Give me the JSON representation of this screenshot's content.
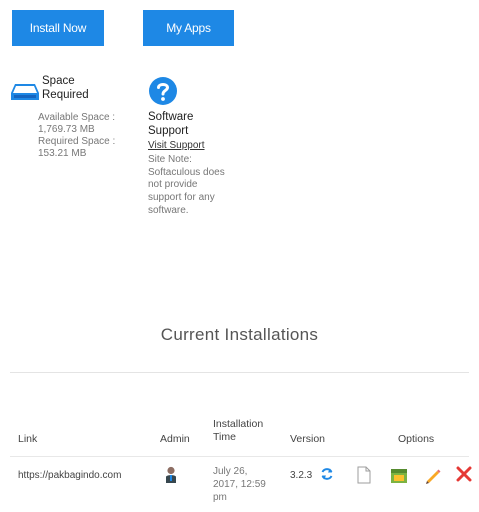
{
  "toolbar": {
    "install_label": "Install Now",
    "myapps_label": "My Apps"
  },
  "space": {
    "title": "Space Required",
    "detail": "Available Space : 1,769.73 MB Required Space : 153.21 MB"
  },
  "support": {
    "title": "Software Support",
    "link": "Visit Support",
    "note": "Site Note: Softaculous does not provide support for any software."
  },
  "section_title": "Current Installations",
  "table": {
    "headers": {
      "link": "Link",
      "admin": "Admin",
      "installation_time": "Installation Time",
      "version": "Version",
      "options": "Options"
    },
    "rows": [
      {
        "link": "https://pakbagindo.com",
        "time": "July 26, 2017, 12:59 pm",
        "version": "3.2.3"
      }
    ]
  },
  "colors": {
    "accent": "#1e88e5",
    "delete": "#e53935",
    "edit": "#f9a825"
  }
}
